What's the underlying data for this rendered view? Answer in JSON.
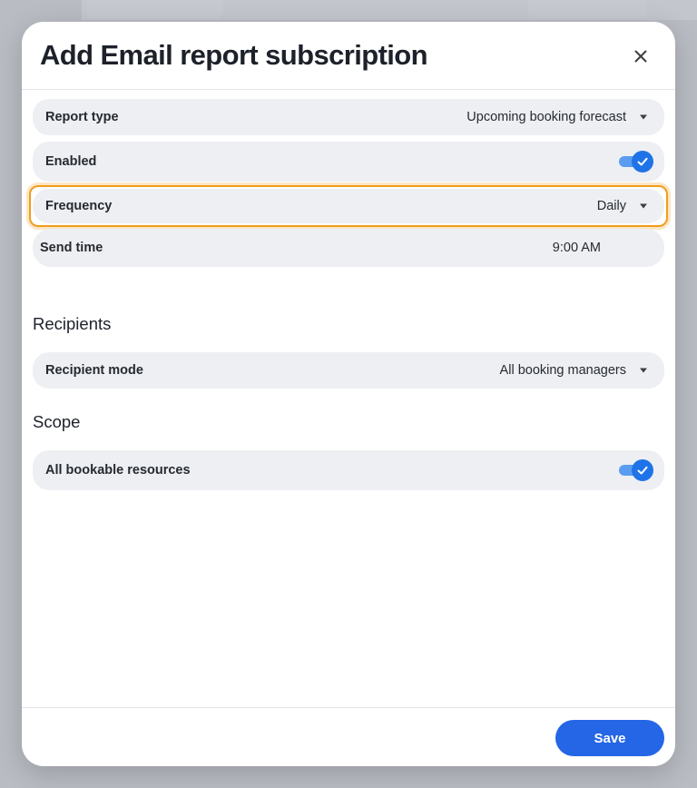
{
  "dialog": {
    "title": "Add Email report subscription",
    "close_icon": "close-icon"
  },
  "settings": {
    "report_type": {
      "label": "Report type",
      "value": "Upcoming booking forecast"
    },
    "enabled": {
      "label": "Enabled",
      "checked": true
    },
    "frequency": {
      "label": "Frequency",
      "value": "Daily"
    },
    "send_time": {
      "label": "Send time",
      "value": "9:00 AM"
    }
  },
  "recipients": {
    "heading": "Recipients",
    "mode": {
      "label": "Recipient mode",
      "value": "All booking managers"
    }
  },
  "scope": {
    "heading": "Scope",
    "all_resources": {
      "label": "All bookable resources",
      "checked": true
    }
  },
  "footer": {
    "save_label": "Save"
  },
  "colors": {
    "accent": "#2466e6",
    "toggle_on": "#1f73e8",
    "focus_ring": "#ef9d1c",
    "row_background": "#edeff2"
  }
}
